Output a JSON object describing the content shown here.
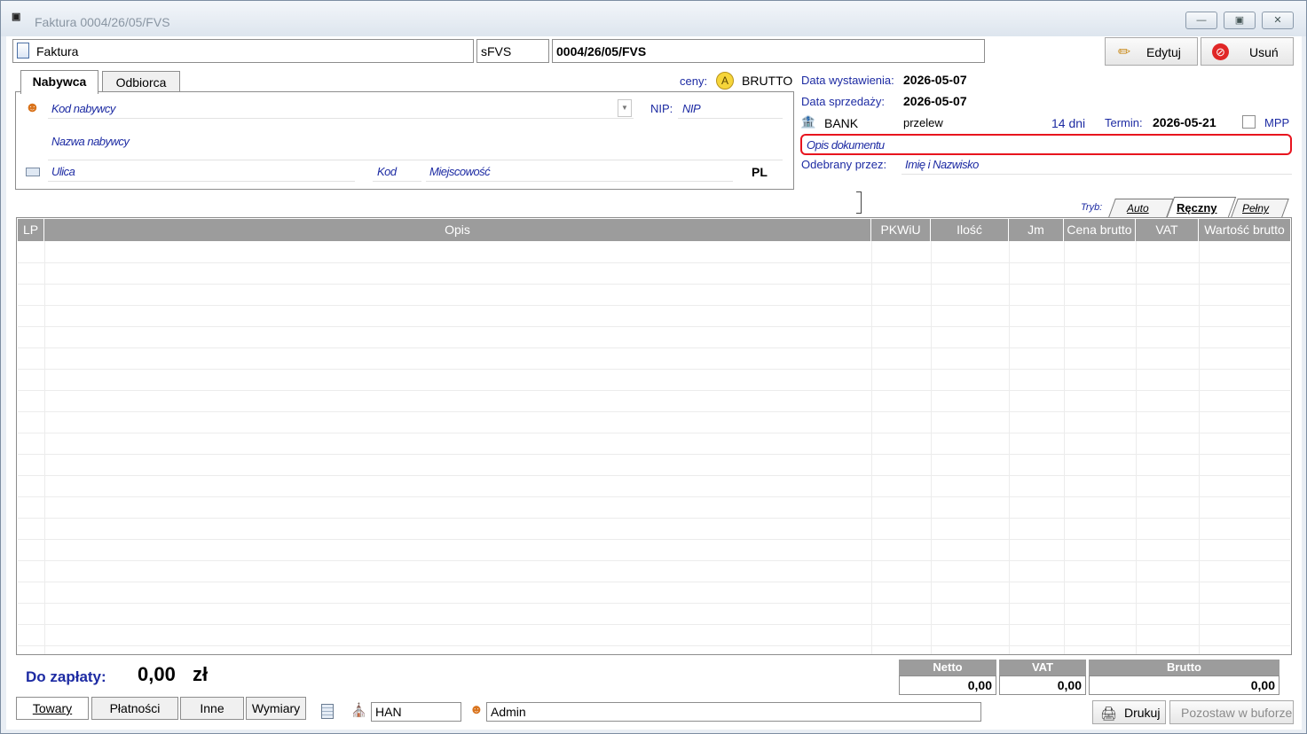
{
  "window": {
    "title": "Faktura 0004/26/05/FVS"
  },
  "toolbar": {
    "doc_type": "Faktura",
    "series": "sFVS",
    "number": "0004/26/05/FVS",
    "edit_label": "Edytuj",
    "delete_label": "Usuń"
  },
  "tabs": {
    "buyer": "Nabywca",
    "receiver": "Odbiorca"
  },
  "prices": {
    "label": "ceny:",
    "mode_badge": "A",
    "mode": "BRUTTO"
  },
  "buyer": {
    "code_placeholder": "Kod nabywcy",
    "nip_label": "NIP:",
    "nip_placeholder": "NIP",
    "name_placeholder": "Nazwa nabywcy",
    "street_placeholder": "Ulica",
    "postcode_placeholder": "Kod",
    "city_placeholder": "Miejscowość",
    "country": "PL"
  },
  "dates": {
    "issue_label": "Data wystawienia:",
    "issue_value": "2026-05-07",
    "sale_label": "Data sprzedaży:",
    "sale_value": "2026-05-07"
  },
  "payment": {
    "account": "BANK",
    "method": "przelew",
    "days": "14 dni",
    "due_label": "Termin:",
    "due_value": "2026-05-21",
    "mpp_label": "MPP"
  },
  "description_placeholder": "Opis dokumentu",
  "received": {
    "label": "Odebrany przez:",
    "placeholder": "Imię i Nazwisko"
  },
  "mode_tabs": {
    "label": "Tryb:",
    "auto": "Auto",
    "manual": "Ręczny",
    "full": "Pełny"
  },
  "grid": {
    "columns": [
      "LP",
      "Opis",
      "PKWiU",
      "Ilość",
      "Jm",
      "Cena brutto",
      "VAT",
      "Wartość brutto"
    ]
  },
  "summary": {
    "to_pay_label": "Do zapłaty:",
    "to_pay_value": "0,00",
    "currency": "zł",
    "netto_label": "Netto",
    "netto_value": "0,00",
    "vat_label": "VAT",
    "vat_value": "0,00",
    "brutto_label": "Brutto",
    "brutto_value": "0,00"
  },
  "bottom_tabs": [
    "Towary",
    "Płatności",
    "Inne",
    "Wymiary"
  ],
  "status": {
    "warehouse": "HAN",
    "user": "Admin",
    "print_label": "Drukuj",
    "buffer_label": "Pozostaw w buforze"
  },
  "colors": {
    "highlight": "#e8141e",
    "header_grey": "#9c9c9c",
    "placeholder_blue": "#1d2ba3"
  }
}
